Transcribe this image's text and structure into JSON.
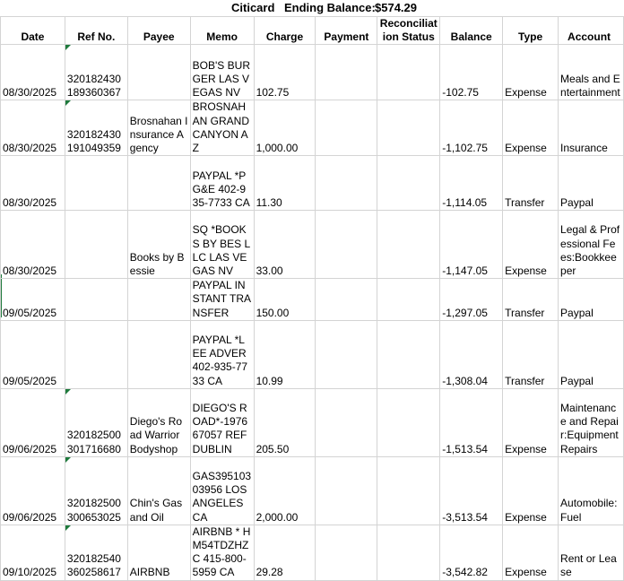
{
  "title": {
    "prefix": "Citicard",
    "label": "Ending Balance:",
    "value": "$574.29"
  },
  "headers": [
    "Date",
    "Ref No.",
    "Payee",
    "Memo",
    "Charge",
    "Payment",
    "Reconciliation Status",
    "Balance",
    "Type",
    "Account"
  ],
  "rows": [
    {
      "date": "08/30/2025",
      "ref": "320182430189360367",
      "payee": "",
      "memo": "BOB'S BURGER LAS VEGAS NV",
      "charge": "102.75",
      "payment": "",
      "status": "",
      "balance": "-102.75",
      "type": "Expense",
      "account": "Meals and Entertainment"
    },
    {
      "date": "08/30/2025",
      "ref": "320182430191049359",
      "payee": "Brosnahan Insurance Agency",
      "memo": "BROSNAHAN GRAND CANYON AZ",
      "charge": "1,000.00",
      "payment": "",
      "status": "",
      "balance": "-1,102.75",
      "type": "Expense",
      "account": "Insurance"
    },
    {
      "date": "08/30/2025",
      "ref": "",
      "payee": "",
      "memo": "PAYPAL *PG&E 402-935-7733 CA",
      "charge": "11.30",
      "payment": "",
      "status": "",
      "balance": "-1,114.05",
      "type": "Transfer",
      "account": "Paypal"
    },
    {
      "date": "08/30/2025",
      "ref": "",
      "payee": "Books by Bessie",
      "memo": "SQ *BOOKS BY BES LLC LAS VEGAS NV",
      "charge": "33.00",
      "payment": "",
      "status": "",
      "balance": "-1,147.05",
      "type": "Expense",
      "account": "Legal & Professional Fees:Bookkeeper"
    },
    {
      "date": "09/05/2025",
      "ref": "",
      "payee": "",
      "memo": "PAYPAL INSTANT TRANSFER",
      "charge": "150.00",
      "payment": "",
      "status": "",
      "balance": "-1,297.05",
      "type": "Transfer",
      "account": "Paypal"
    },
    {
      "date": "09/05/2025",
      "ref": "",
      "payee": "",
      "memo": "PAYPAL *LEE ADVER 402-935-7733 CA",
      "charge": "10.99",
      "payment": "",
      "status": "",
      "balance": "-1,308.04",
      "type": "Transfer",
      "account": "Paypal"
    },
    {
      "date": "09/06/2025",
      "ref": "320182500301716680",
      "payee": "Diego's Road Warrior Bodyshop",
      "memo": "DIEGO'S ROAD*-197667057 REFDUBLIN",
      "charge": "205.50",
      "payment": "",
      "status": "",
      "balance": "-1,513.54",
      "type": "Expense",
      "account": "Maintenance and Repair:Equipment Repairs"
    },
    {
      "date": "09/06/2025",
      "ref": "320182500300653025",
      "payee": "Chin's Gas and Oil",
      "memo": "GAS39510303956 LOS ANGELES CA",
      "charge": "2,000.00",
      "payment": "",
      "status": "",
      "balance": "-3,513.54",
      "type": "Expense",
      "account": "Automobile:Fuel"
    },
    {
      "date": "09/10/2025",
      "ref": "320182540360258617",
      "payee": "AIRBNB",
      "memo": "AIRBNB * HM54TDZHZC 415-800-5959 CA",
      "charge": "29.28",
      "payment": "",
      "status": "",
      "balance": "-3,542.82",
      "type": "Expense",
      "account": "Rent or Lease"
    }
  ]
}
